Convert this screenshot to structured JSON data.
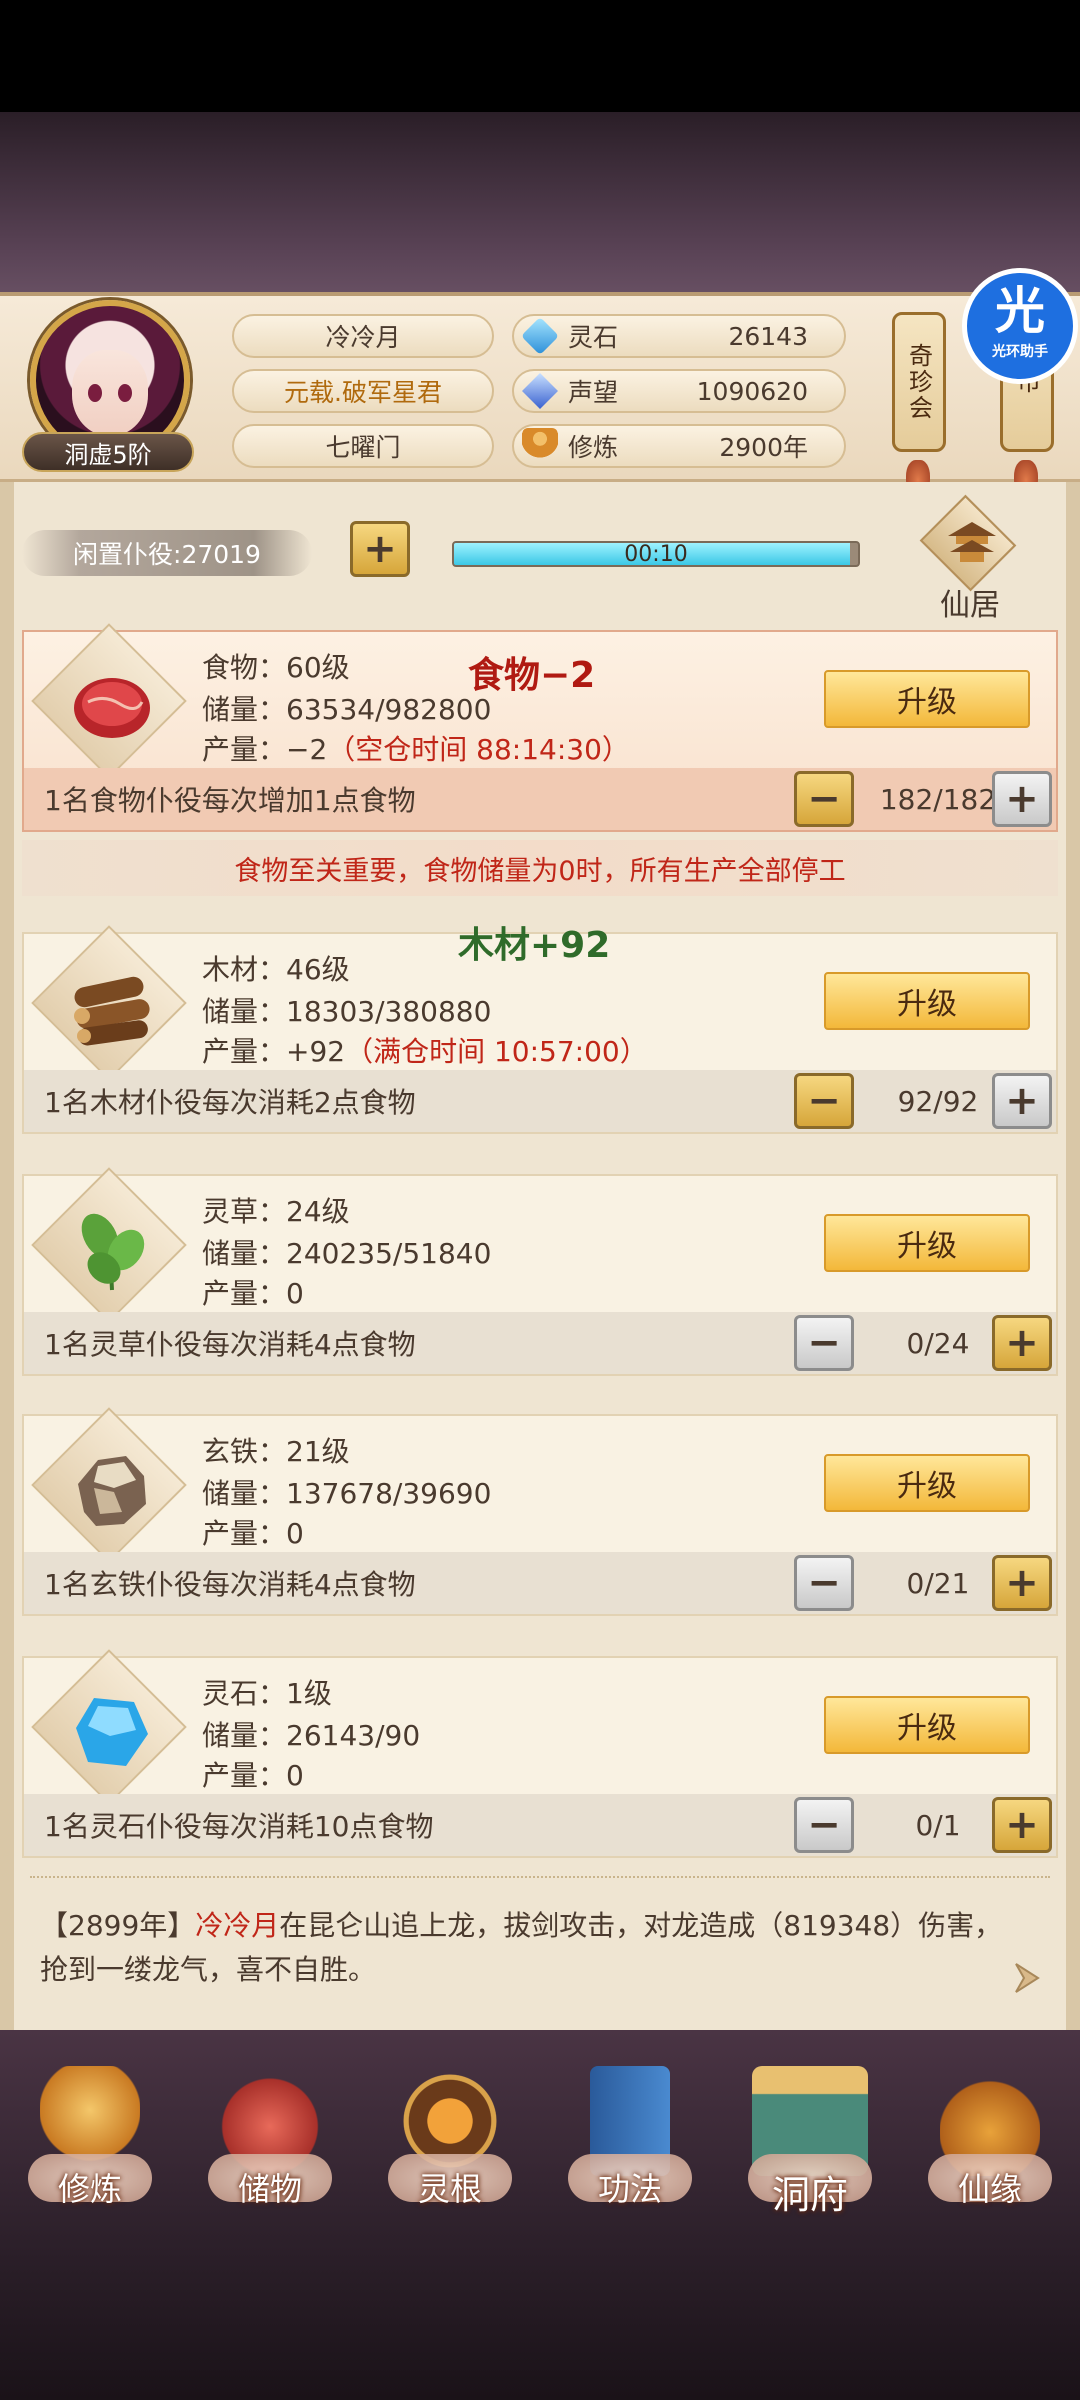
{
  "player": {
    "name": "冷冷月",
    "title": "元载.破军星君",
    "sect": "七曜门",
    "rank": "洞虚5阶"
  },
  "stats": [
    {
      "label": "灵石",
      "value": "26143",
      "icon": "spirit-stone-icon",
      "color": "#3aa7e6"
    },
    {
      "label": "声望",
      "value": "1090620",
      "icon": "reputation-crystal-icon",
      "color": "#4a7fe0"
    },
    {
      "label": "修炼",
      "value": "2900年",
      "icon": "meditation-icon",
      "color": "#d98a2a"
    }
  ],
  "side_buttons": {
    "treasure": "奇珍会",
    "market": "市"
  },
  "watermark": {
    "glyph": "光",
    "text": "光环助手"
  },
  "servants": {
    "label": "闲置仆役:27019",
    "timer": "00:10",
    "timer_progress": 0.98
  },
  "residence": {
    "label": "仙居"
  },
  "upgrade_label": "升级",
  "notice": "食物至关重要，食物储量为0时，所有生产全部停工",
  "float_food": "食物−2",
  "float_wood": "木材+92",
  "resources": [
    {
      "name": "食物：60级",
      "storage": "储量：63534/982800",
      "output": "产量：−2",
      "output_note": "（空仓时间 88:14:30）",
      "consume": "1名食物仆役每次增加1点食物",
      "count": "182/182",
      "minus_active": true,
      "plus_active": false,
      "icon": "meat-icon"
    },
    {
      "name": "木材：46级",
      "storage": "储量：18303/380880",
      "output": "产量：+92",
      "output_note": "（满仓时间 10:57:00）",
      "consume": "1名木材仆役每次消耗2点食物",
      "count": "92/92",
      "minus_active": true,
      "plus_active": false,
      "icon": "wood-logs-icon"
    },
    {
      "name": "灵草：24级",
      "storage": "储量：240235/51840",
      "output": "产量：0",
      "output_note": "",
      "consume": "1名灵草仆役每次消耗4点食物",
      "count": "0/24",
      "minus_active": false,
      "plus_active": true,
      "icon": "herb-icon"
    },
    {
      "name": "玄铁：21级",
      "storage": "储量：137678/39690",
      "output": "产量：0",
      "output_note": "",
      "consume": "1名玄铁仆役每次消耗4点食物",
      "count": "0/21",
      "minus_active": false,
      "plus_active": true,
      "icon": "iron-ore-icon"
    },
    {
      "name": "灵石：1级",
      "storage": "储量：26143/90",
      "output": "产量：0",
      "output_note": "",
      "consume": "1名灵石仆役每次消耗10点食物",
      "count": "0/1",
      "minus_active": false,
      "plus_active": true,
      "icon": "spirit-stone-icon"
    }
  ],
  "log": {
    "prefix": "【2899年】",
    "name": "冷冷月",
    "text": "在昆仑山追上龙，拔剑攻击，对龙造成（819348）伤害，抢到一缕龙气，喜不自胜。"
  },
  "nav": [
    {
      "label": "修炼",
      "icon": "cultivation-icon"
    },
    {
      "label": "储物",
      "icon": "storage-bag-icon"
    },
    {
      "label": "灵根",
      "icon": "spirit-root-icon"
    },
    {
      "label": "功法",
      "icon": "technique-book-icon"
    },
    {
      "label": "洞府",
      "icon": "cave-mansion-icon",
      "active": true
    },
    {
      "label": "仙缘",
      "icon": "fate-gourd-icon"
    }
  ]
}
